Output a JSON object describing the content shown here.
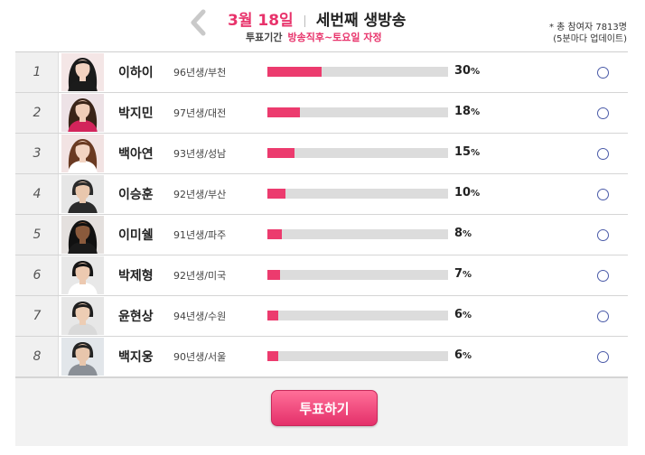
{
  "header": {
    "date": "3월 18일",
    "episode": "세번째 생방송",
    "period_label": "투표기간",
    "period_value": "방송직후~토요일 자정",
    "note_line1": "* 총 참여자 7813명",
    "note_line2": "(5분마다 업데이트)"
  },
  "contestants": [
    {
      "rank": "1",
      "name": "이하이",
      "info": "96년생/부천",
      "percent": 30,
      "pct_num": "30",
      "pct_unit": "%"
    },
    {
      "rank": "2",
      "name": "박지민",
      "info": "97년생/대전",
      "percent": 18,
      "pct_num": "18",
      "pct_unit": "%"
    },
    {
      "rank": "3",
      "name": "백아연",
      "info": "93년생/성남",
      "percent": 15,
      "pct_num": "15",
      "pct_unit": "%"
    },
    {
      "rank": "4",
      "name": "이승훈",
      "info": "92년생/부산",
      "percent": 10,
      "pct_num": "10",
      "pct_unit": "%"
    },
    {
      "rank": "5",
      "name": "이미쉘",
      "info": "91년생/파주",
      "percent": 8,
      "pct_num": "8",
      "pct_unit": "%"
    },
    {
      "rank": "6",
      "name": "박제형",
      "info": "92년생/미국",
      "percent": 7,
      "pct_num": "7",
      "pct_unit": "%"
    },
    {
      "rank": "7",
      "name": "윤현상",
      "info": "94년생/수원",
      "percent": 6,
      "pct_num": "6",
      "pct_unit": "%"
    },
    {
      "rank": "8",
      "name": "백지웅",
      "info": "90년생/서울",
      "percent": 6,
      "pct_num": "6",
      "pct_unit": "%"
    }
  ],
  "footer": {
    "vote_label": "투표하기"
  },
  "colors": {
    "accent": "#e8336b",
    "bar_fill": "#ec3b6e",
    "bar_track": "#dcdcdc",
    "radio_border": "#4a5aa8"
  },
  "icons": {
    "prev": "chevron-left-icon",
    "radio": "radio-empty-icon"
  }
}
